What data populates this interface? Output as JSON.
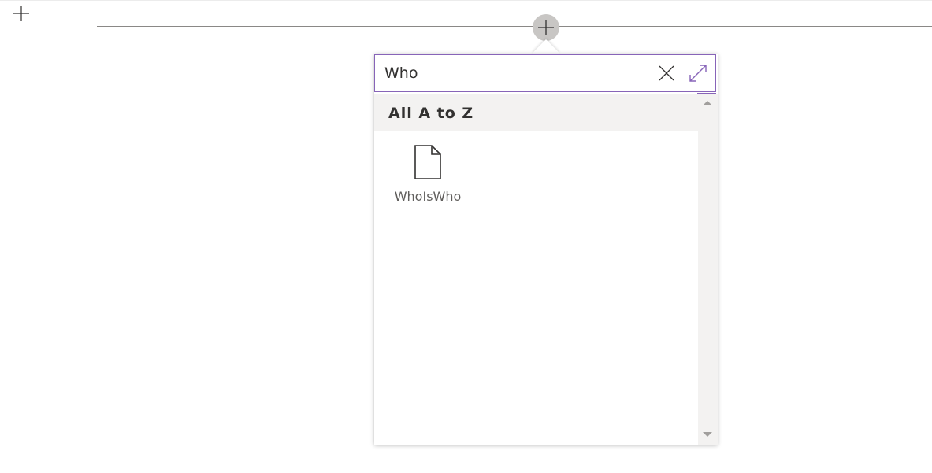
{
  "section_toolbar": {
    "add_section_icon": "plus-icon"
  },
  "webpart_toolbar": {
    "add_webpart_icon": "plus-icon"
  },
  "toolbox": {
    "search": {
      "value": "Who",
      "clear_icon": "close-icon",
      "expand_icon": "expand-icon"
    },
    "group": {
      "header": "All A to Z",
      "items": [
        {
          "label": "WhoIsWho",
          "icon": "document-icon"
        }
      ]
    },
    "scrollbar": {
      "up_icon": "triangle-up-icon",
      "down_icon": "triangle-down-icon"
    }
  },
  "colors": {
    "accent": "#8764b8",
    "header_bg": "#f3f2f1",
    "add_circle": "#c8c6c4"
  }
}
